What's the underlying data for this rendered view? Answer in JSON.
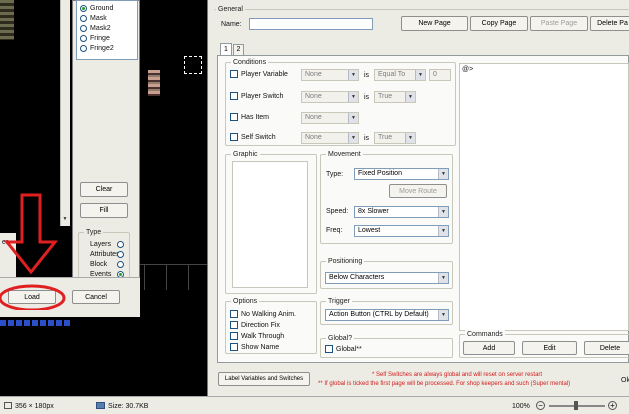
{
  "left_window": {
    "layers": [
      "Ground",
      "Mask",
      "Mask2",
      "Fringe",
      "Fringe2"
    ],
    "selected_layer": "Ground",
    "clear_label": "Clear",
    "fill_label": "Fill",
    "type_caption": "Type",
    "types": [
      "Layers",
      "Attributes",
      "Block",
      "Events"
    ],
    "selected_type": "Events",
    "left_fragment": "er",
    "load_label": "Load",
    "cancel_label": "Cancel"
  },
  "event_editor": {
    "general_caption": "General",
    "name_label": "Name:",
    "name_value": "",
    "new_page": "New Page",
    "copy_page": "Copy Page",
    "paste_page": "Paste Page",
    "delete_page": "Delete Pa",
    "tabs": [
      "1",
      "2"
    ],
    "conditions": {
      "caption": "Conditions",
      "player_variable": "Player Variable",
      "player_switch": "Player Switch",
      "has_item": "Has Item",
      "self_switch": "Self Switch",
      "none": "None",
      "is": "is",
      "equal_to": "Equal To",
      "true_value": "True",
      "variable_value": "0"
    },
    "graphic_caption": "Graphic",
    "movement": {
      "caption": "Movement",
      "type_label": "Type:",
      "type_value": "Fixed Position",
      "move_route": "Move Route",
      "speed_label": "Speed:",
      "speed_value": "8x Slower",
      "freq_label": "Freq:",
      "freq_value": "Lowest"
    },
    "positioning": {
      "caption": "Positioning",
      "value": "Below Characters"
    },
    "options": {
      "caption": "Options",
      "items": [
        "No Walking Anim.",
        "Direction Fix",
        "Walk Through",
        "Show Name"
      ]
    },
    "trigger": {
      "caption": "Trigger",
      "value": "Action Button (CTRL by Default)"
    },
    "global": {
      "caption": "Global?",
      "label": "Global**"
    },
    "commands_list_first": "@>",
    "commands": {
      "caption": "Commands",
      "add": "Add",
      "edit": "Edit",
      "delete": "Delete"
    },
    "label_variables_button": "Label Variables and Switches",
    "note1": "* Self Switches are always global and will reset on server restart",
    "note2": "** If global is ticked the first page will be processed. For shop keepers and such (Super mental)",
    "ok_fragment": "Ok"
  },
  "status_bar": {
    "dimensions": "356 × 180px",
    "size": "Size: 30.7KB",
    "zoom": "100%"
  },
  "annotation": {
    "color": "#e02020"
  }
}
